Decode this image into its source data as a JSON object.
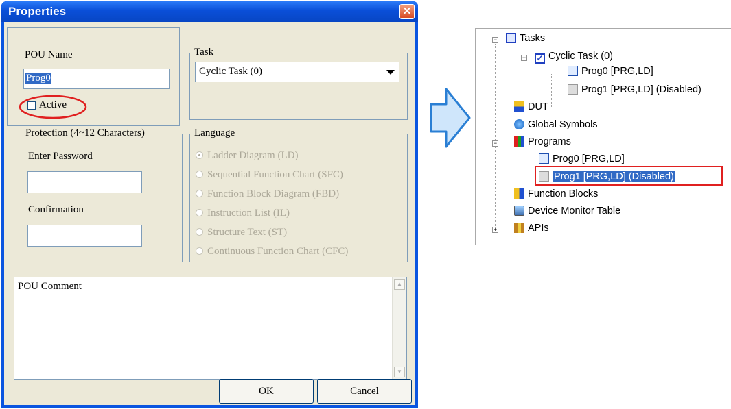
{
  "dialog": {
    "title": "Properties",
    "pou_name_label": "POU Name",
    "pou_name_value": "Prog0",
    "active_label": "Active",
    "task_legend": "Task",
    "task_value": "Cyclic Task (0)",
    "protection_legend": "Protection (4~12 Characters)",
    "enter_password_label": "Enter Password",
    "confirmation_label": "Confirmation",
    "language_legend": "Language",
    "languages": [
      "Ladder Diagram (LD)",
      "Sequential Function Chart (SFC)",
      "Function Block Diagram (FBD)",
      "Instruction List (IL)",
      "Structure Text (ST)",
      "Continuous Function Chart (CFC)"
    ],
    "comment_text": "POU Comment",
    "ok_label": "OK",
    "cancel_label": "Cancel"
  },
  "tree": {
    "tasks": "Tasks",
    "cyclic_task": "Cyclic Task (0)",
    "task_prog0": "Prog0 [PRG,LD]",
    "task_prog1": "Prog1 [PRG,LD] (Disabled)",
    "dut": "DUT",
    "global_symbols": "Global Symbols",
    "programs": "Programs",
    "prog0": "Prog0 [PRG,LD]",
    "prog1": "Prog1 [PRG,LD] (Disabled)",
    "function_blocks": "Function Blocks",
    "device_monitor_table": "Device Monitor Table",
    "apis": "APIs"
  },
  "colors": {
    "highlight_circle": "#e02020",
    "selection_box": "#e02020",
    "selected_bg": "#316ac5",
    "arrow_fill": "#cfe6fb",
    "arrow_stroke": "#2a7fd4"
  }
}
